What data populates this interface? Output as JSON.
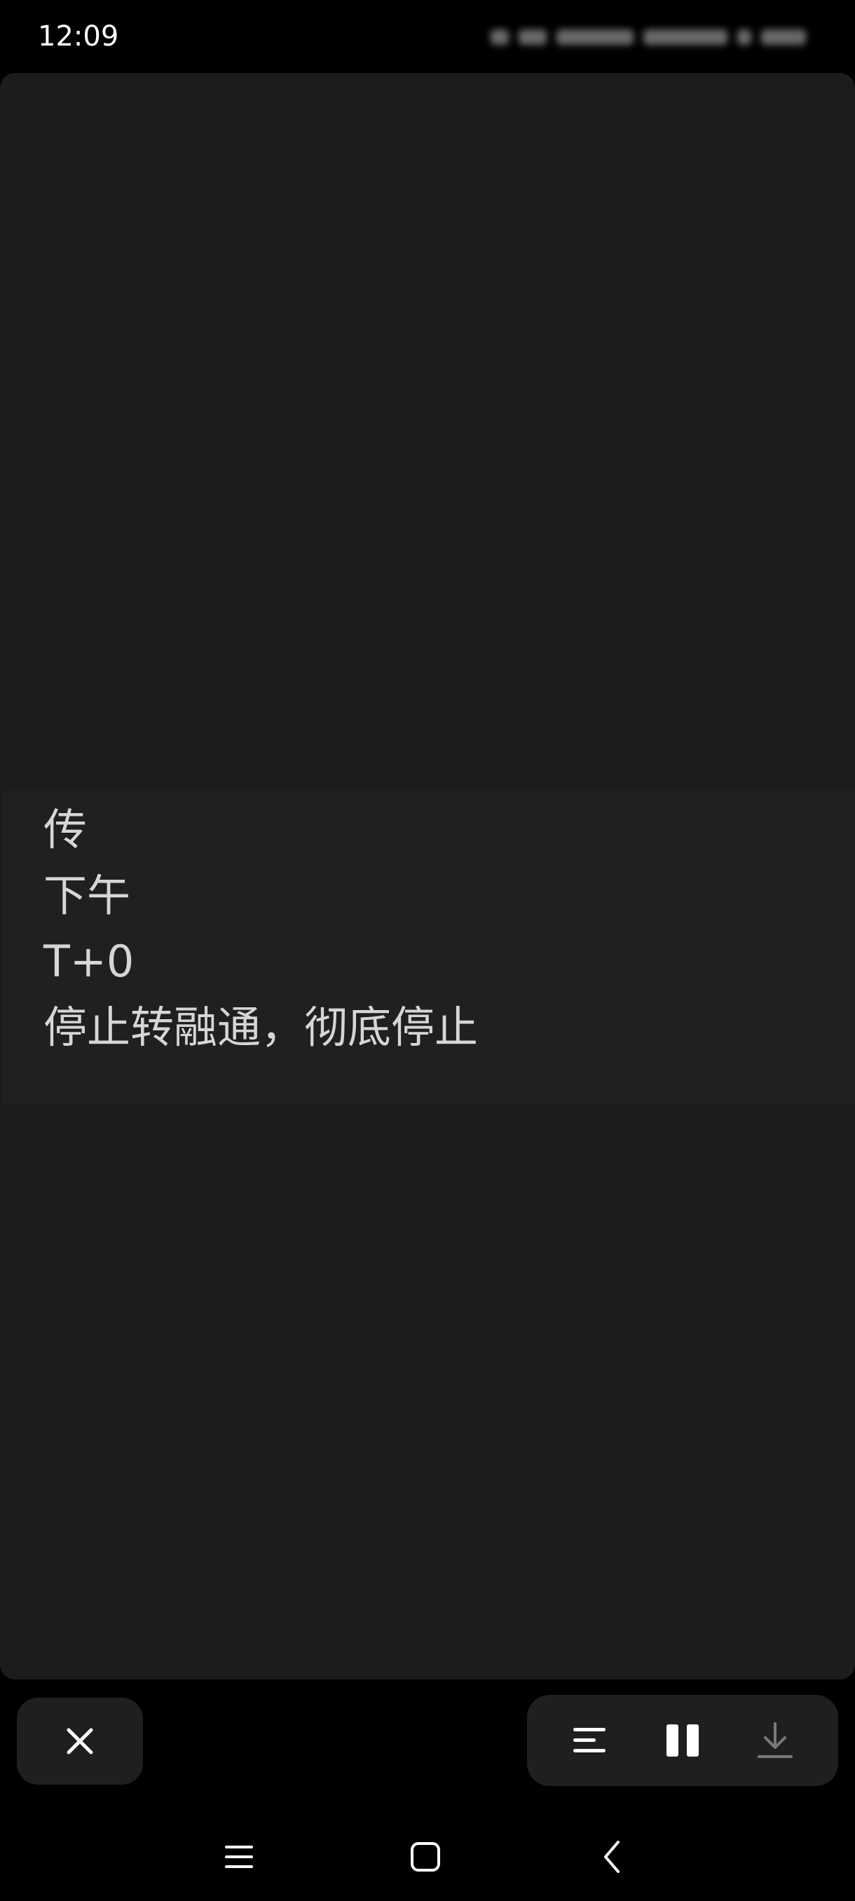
{
  "status_bar": {
    "time": "12:09"
  },
  "transcript": {
    "lines": [
      "传",
      "下午",
      "T+0",
      "停止转融通，彻底停止"
    ]
  },
  "controls": {
    "close_icon": "close-icon",
    "align_icon": "text-align-icon",
    "pause_icon": "pause-icon",
    "download_icon": "download-icon"
  },
  "nav": {
    "menu_icon": "menu-icon",
    "home_icon": "home-icon",
    "back_icon": "back-icon"
  },
  "colors": {
    "background": "#000000",
    "panel": "#1c1c1c",
    "text_highlight": "#202020",
    "text": "#d6d6d6",
    "button": "#1f1f1f"
  }
}
